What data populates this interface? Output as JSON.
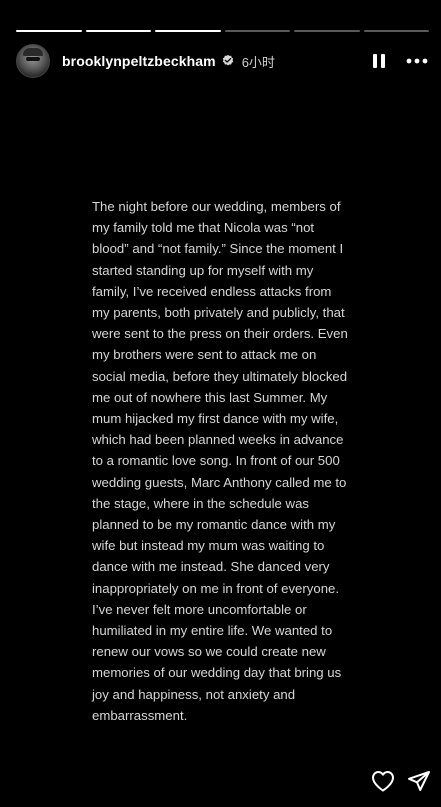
{
  "story": {
    "progress_segments": 6,
    "progress_completed": 3,
    "progress_colors": {
      "done": "#ffffff",
      "pending": "#5a5a5a"
    }
  },
  "header": {
    "username": "brooklynpeltzbeckham",
    "verified": true,
    "time_ago": "6小时",
    "icons": {
      "pause": "pause-icon",
      "more": "more-dots-icon",
      "verified": "verified-badge-icon"
    }
  },
  "content": {
    "text": "The night before our wedding, members of\nmy family told me that Nicola was “not\nblood” and “not family.” Since the moment I\nstarted standing up for myself with my\nfamily, I’ve received endless attacks from\nmy parents, both privately and publicly, that\nwere sent to the press on their orders. Even\nmy brothers were sent to attack me on\nsocial media, before they ultimately blocked\nme out of nowhere this last Summer. My\nmum hijacked my first dance with my wife,\nwhich had been planned weeks in advance\nto a romantic love song. In front of our 500\nwedding guests, Marc Anthony called me to\nthe stage, where in the schedule was\nplanned to be my romantic dance with my\nwife but instead my mum was waiting to\ndance with me instead. She danced very\ninappropriately on me in front of everyone.\nI’ve never felt more uncomfortable or\nhumiliated in my entire life. We wanted to\nrenew our vows so we could create new\nmemories of our wedding day that bring us\njoy and happiness, not anxiety and\nembarrassment."
  },
  "footer": {
    "icons": {
      "like": "heart-icon",
      "share": "send-icon"
    }
  }
}
